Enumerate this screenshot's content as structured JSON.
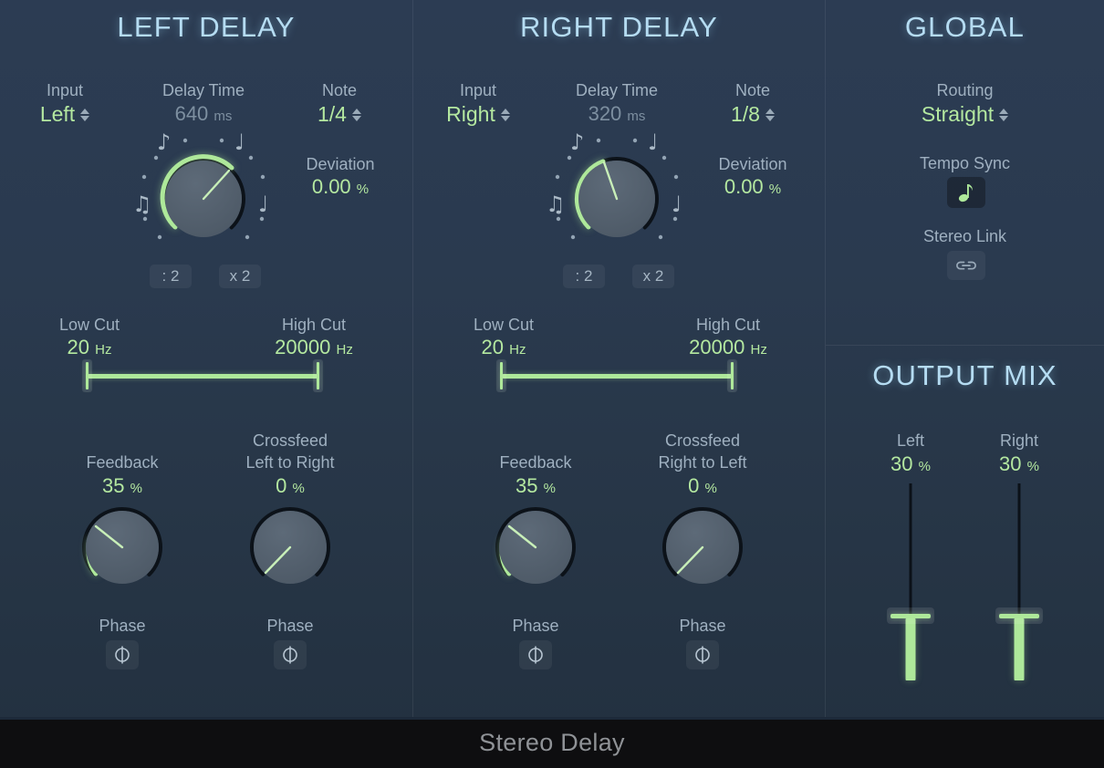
{
  "window": {
    "plugin_title": "Stereo Delay"
  },
  "sections": {
    "left_delay": {
      "title": "LEFT DELAY",
      "input": {
        "label": "Input",
        "value": "Left"
      },
      "delay_time": {
        "label": "Delay Time",
        "value": "640",
        "unit": "ms"
      },
      "note": {
        "label": "Note",
        "value": "1/4"
      },
      "deviation": {
        "label": "Deviation",
        "value": "0.00",
        "unit": "%"
      },
      "halve_button": ": 2",
      "double_button": "x 2",
      "low_cut": {
        "label": "Low Cut",
        "value": "20",
        "unit": "Hz"
      },
      "high_cut": {
        "label": "High Cut",
        "value": "20000",
        "unit": "Hz"
      },
      "feedback": {
        "label": "Feedback",
        "value": "35",
        "unit": "%"
      },
      "crossfeed": {
        "label": "Crossfeed",
        "sublabel": "Left to Right",
        "value": "0",
        "unit": "%"
      },
      "phase_feedback": {
        "label": "Phase",
        "icon": "phase-icon"
      },
      "phase_crossfeed": {
        "label": "Phase",
        "icon": "phase-icon"
      }
    },
    "right_delay": {
      "title": "RIGHT DELAY",
      "input": {
        "label": "Input",
        "value": "Right"
      },
      "delay_time": {
        "label": "Delay Time",
        "value": "320",
        "unit": "ms"
      },
      "note": {
        "label": "Note",
        "value": "1/8"
      },
      "deviation": {
        "label": "Deviation",
        "value": "0.00",
        "unit": "%"
      },
      "halve_button": ": 2",
      "double_button": "x 2",
      "low_cut": {
        "label": "Low Cut",
        "value": "20",
        "unit": "Hz"
      },
      "high_cut": {
        "label": "High Cut",
        "value": "20000",
        "unit": "Hz"
      },
      "feedback": {
        "label": "Feedback",
        "value": "35",
        "unit": "%"
      },
      "crossfeed": {
        "label": "Crossfeed",
        "sublabel": "Right to Left",
        "value": "0",
        "unit": "%"
      },
      "phase_feedback": {
        "label": "Phase",
        "icon": "phase-icon"
      },
      "phase_crossfeed": {
        "label": "Phase",
        "icon": "phase-icon"
      }
    },
    "global": {
      "title": "GLOBAL",
      "routing": {
        "label": "Routing",
        "value": "Straight"
      },
      "tempo_sync": {
        "label": "Tempo Sync",
        "icon": "eighth-note-icon",
        "state": "on"
      },
      "stereo_link": {
        "label": "Stereo Link",
        "icon": "link-icon",
        "state": "off"
      }
    },
    "output_mix": {
      "title": "OUTPUT MIX",
      "left": {
        "label": "Left",
        "value": "30",
        "unit": "%"
      },
      "right": {
        "label": "Right",
        "value": "30",
        "unit": "%"
      }
    }
  },
  "colors": {
    "accent_green": "#b4e8a0",
    "header_blue": "#b5dcf2",
    "label_gray": "#9fb0c0",
    "background_top": "#2c3c53",
    "background_bottom": "#22303f",
    "footer": "#0e0e10"
  },
  "control_states": {
    "left_delay_time_knob_percent": 72,
    "right_delay_time_knob_percent": 50,
    "left_feedback_knob_percent": 35,
    "left_crossfeed_knob_percent": 0,
    "right_feedback_knob_percent": 35,
    "right_crossfeed_knob_percent": 0,
    "output_left_fader_percent": 30,
    "output_right_fader_percent": 30,
    "lowcut_slider_percent": 0,
    "highcut_slider_percent": 100
  }
}
